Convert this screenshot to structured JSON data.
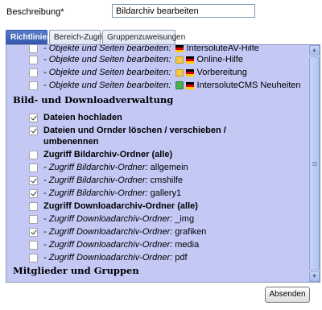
{
  "form": {
    "description_label": "Beschreibung*",
    "description_value": "Bildarchiv bearbeiten"
  },
  "tabs": [
    {
      "label": "Richtlinien",
      "active": true
    },
    {
      "label": "Bereich-Zugriff",
      "active": false
    },
    {
      "label": "Gruppenzuweisungen",
      "active": false
    }
  ],
  "rows": [
    {
      "prefix": "- Objekte und Seiten bearbeiten:",
      "text": "IntersoluteAV-Hilfe",
      "icon": "flag-icon",
      "checked": false
    },
    {
      "prefix": "- Objekte und Seiten bearbeiten:",
      "text": "Online-Hilfe",
      "icon": "folder-flag-icon",
      "checked": false
    },
    {
      "prefix": "- Objekte und Seiten bearbeiten:",
      "text": "Vorbereitung",
      "icon": "folder-flag-icon",
      "checked": false
    },
    {
      "prefix": "- Objekte und Seiten bearbeiten:",
      "text": "IntersoluteCMS Neuheiten",
      "icon": "globe-flag-icon",
      "checked": false
    }
  ],
  "section_bild": "Bild- und Downloadverwaltung",
  "bild_items": [
    {
      "text": "Dateien hochladen",
      "bold": true,
      "checked": true
    },
    {
      "text": "Dateien und Ornder löschen / verschieben /",
      "text2": "umbenennen",
      "bold": true,
      "checked": true
    },
    {
      "text": "Zugriff Bildarchiv-Ordner (alle)",
      "bold": true,
      "checked": false
    },
    {
      "prefix": "- Zugriff Bildarchiv-Ordner:",
      "text": "allgemein",
      "checked": false
    },
    {
      "prefix": "- Zugriff Bildarchiv-Ordner:",
      "text": "cmshilfe",
      "checked": true
    },
    {
      "prefix": "- Zugriff Bildarchiv-Ordner:",
      "text": "gallery1",
      "checked": true
    },
    {
      "text": "Zugriff Downloadarchiv-Ordner (alle)",
      "bold": true,
      "checked": false
    },
    {
      "prefix": "- Zugriff Downloadarchiv-Ordner:",
      "text": "_img",
      "checked": false
    },
    {
      "prefix": "- Zugriff Downloadarchiv-Ordner:",
      "text": "grafiken",
      "checked": true
    },
    {
      "prefix": "- Zugriff Downloadarchiv-Ordner:",
      "text": "media",
      "checked": false
    },
    {
      "prefix": "- Zugriff Downloadarchiv-Ordner:",
      "text": "pdf",
      "checked": false
    }
  ],
  "section_mitglieder": "Mitglieder und Gruppen",
  "button_label": "Absenden"
}
